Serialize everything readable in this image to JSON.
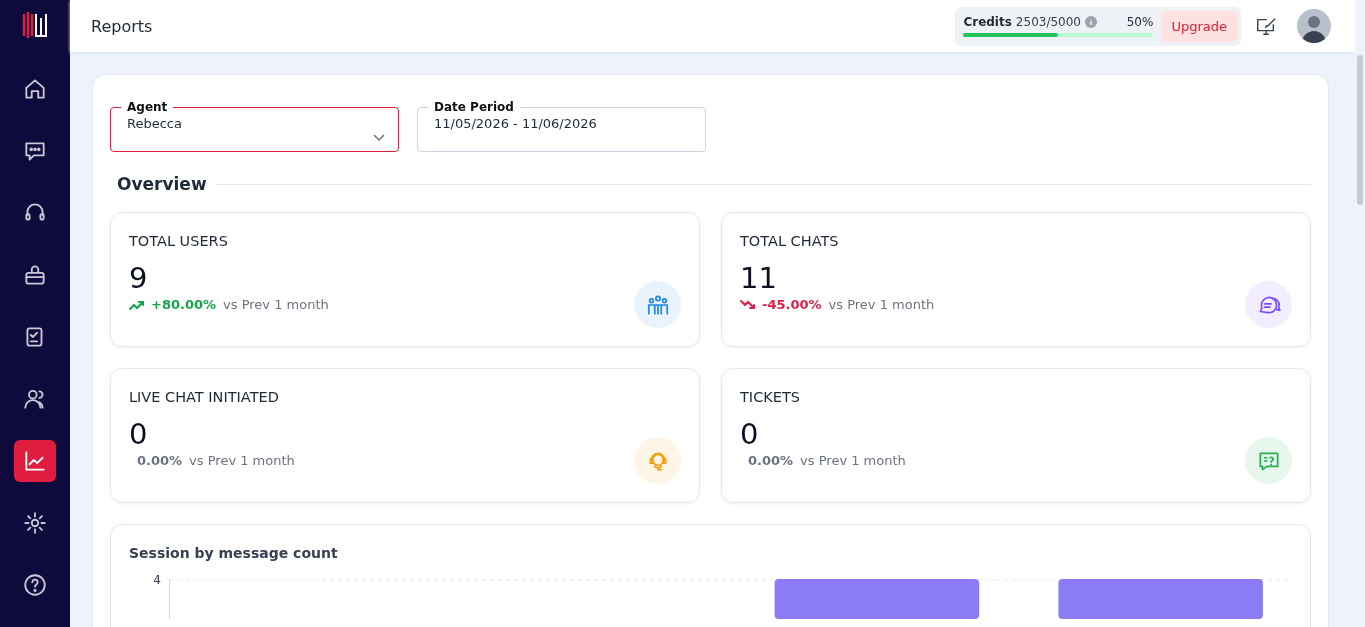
{
  "sidebar": {
    "items": [
      {
        "kind": "home",
        "selected": false
      },
      {
        "kind": "chat",
        "selected": false
      },
      {
        "kind": "headset",
        "selected": false
      },
      {
        "kind": "bag",
        "selected": false
      },
      {
        "kind": "checklist",
        "selected": false
      },
      {
        "kind": "users",
        "selected": false
      },
      {
        "kind": "reports",
        "selected": true
      },
      {
        "kind": "settings",
        "selected": false
      },
      {
        "kind": "help",
        "selected": false
      }
    ]
  },
  "header": {
    "title": "Reports",
    "credits": {
      "label": "Credits",
      "value": "2503/5000",
      "percent": "50%",
      "level": 0.5
    },
    "upgrade": "Upgrade"
  },
  "filters": [
    {
      "label": "Agent",
      "value": "Rebecca",
      "kind": "select",
      "focused": true
    },
    {
      "label": "Date Period",
      "value": "11/05/2026 - 11/06/2026",
      "kind": "date",
      "focused": false
    }
  ],
  "overview": {
    "title": "Overview",
    "metrics": [
      {
        "title": "TOTAL USERS",
        "value": "9",
        "kind": "up",
        "change": "+80.00%",
        "comparison": "vs Prev 1 month",
        "color": "#1e88e5"
      },
      {
        "title": "TOTAL CHATS",
        "value": "11",
        "kind": "down",
        "change": "-45.00%",
        "comparison": "vs Prev 1 month",
        "color": "#7c4dff"
      },
      {
        "title": "LIVE CHAT INITIATED",
        "value": "0",
        "kind": "flat",
        "change": "0.00%",
        "comparison": "vs Prev 1 month",
        "color": "#f59e0b"
      },
      {
        "title": "TICKETS",
        "value": "0",
        "kind": "flat",
        "change": "0.00%",
        "comparison": "vs Prev 1 month",
        "color": "#22b14c"
      }
    ]
  },
  "session_chart": {
    "title": "Session by message count",
    "y_tick": "4"
  }
}
